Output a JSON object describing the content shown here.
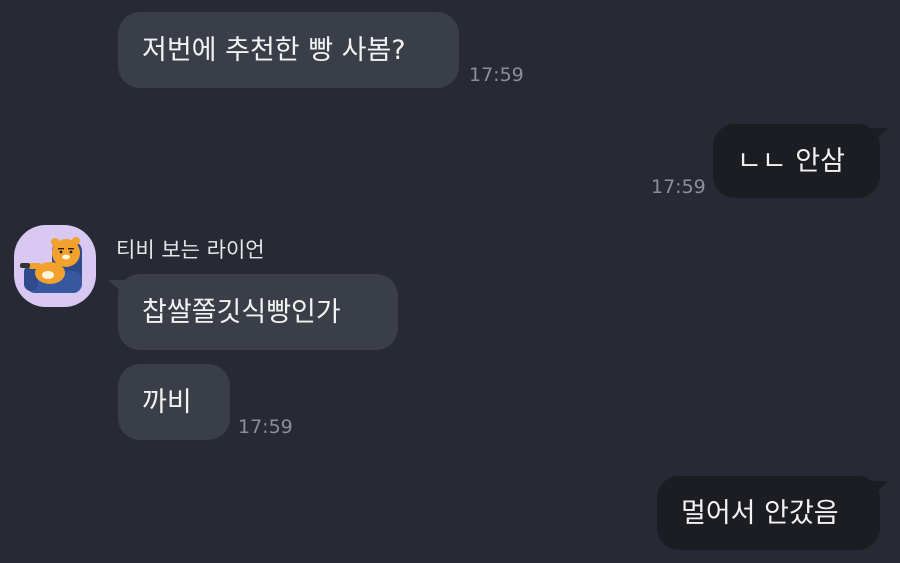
{
  "messages": [
    {
      "text": "저번에 추천한 빵 사봄?",
      "time": "17:59"
    },
    {
      "text": "ㄴㄴ 안삼",
      "time": "17:59"
    },
    {
      "sender": "티비 보는 라이언",
      "text": "찹쌀쫄깃식빵인가"
    },
    {
      "text": "까비",
      "time": "17:59"
    },
    {
      "text": "멀어서 안갔음"
    }
  ],
  "colors": {
    "background": "#272a34",
    "incoming_bubble": "#3a3e49",
    "outgoing_bubble": "#1c1d22",
    "timestamp": "#8c8f98"
  },
  "icons": {
    "avatar": "ryan-watching-tv-icon"
  }
}
